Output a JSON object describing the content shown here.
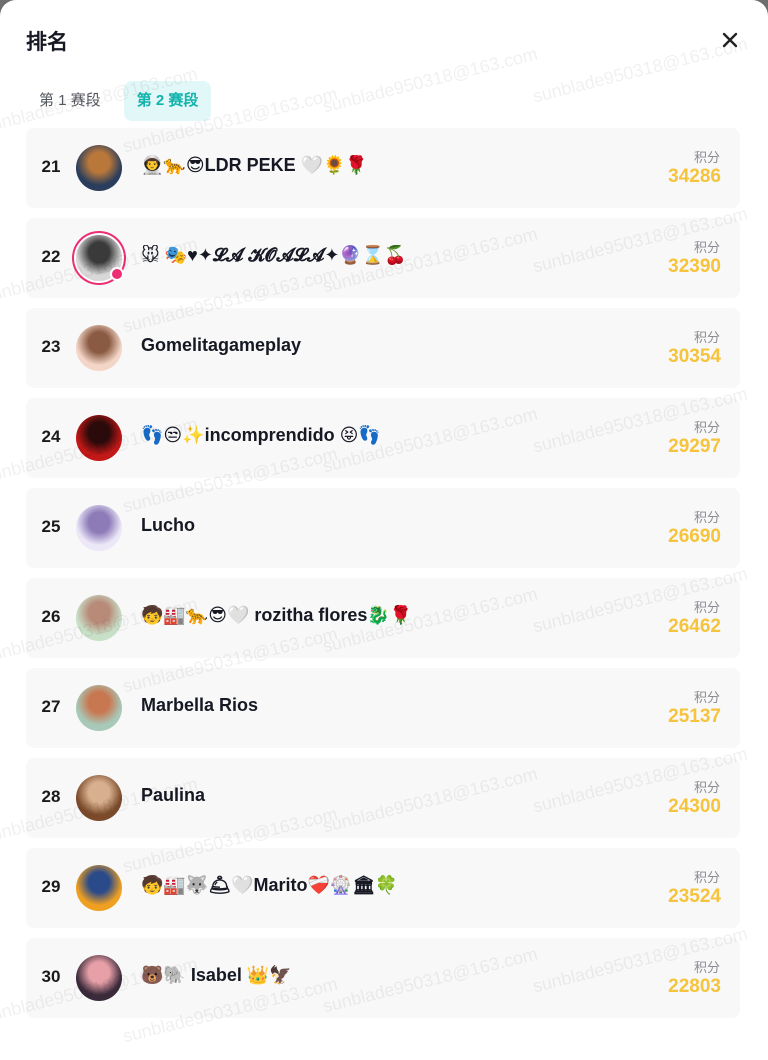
{
  "modal": {
    "title": "排名",
    "tabs": [
      {
        "label": "第 1 赛段",
        "active": false
      },
      {
        "label": "第 2 赛段",
        "active": true
      }
    ]
  },
  "points_label": "积分",
  "rankings": [
    {
      "rank": "21",
      "name": "👨‍🚀🐆😎LDR PEKE 🤍🌻🌹",
      "points": "34286",
      "avatar_colors": [
        "#2a3d5c",
        "#b9783a"
      ],
      "live": false
    },
    {
      "rank": "22",
      "name": "🐭 🎭♥✦𝓛𝓐 𝓚𝓞𝓐𝓛𝓐✦🔮⌛🍒",
      "points": "32390",
      "avatar_colors": [
        "#d8d8d8",
        "#3a3a3a"
      ],
      "live": true
    },
    {
      "rank": "23",
      "name": "Gomelitagameplay",
      "points": "30354",
      "avatar_colors": [
        "#f4d6c8",
        "#8a5a42"
      ],
      "live": false
    },
    {
      "rank": "24",
      "name": "👣😒✨incomprendido 😝👣",
      "points": "29297",
      "avatar_colors": [
        "#c21818",
        "#2a0a0a"
      ],
      "live": false
    },
    {
      "rank": "25",
      "name": "Lucho",
      "points": "26690",
      "avatar_colors": [
        "#ece8f8",
        "#8d7bb8"
      ],
      "live": false
    },
    {
      "rank": "26",
      "name": "🧒🏭🐆😎🤍 rozitha flores🐉🌹",
      "points": "26462",
      "avatar_colors": [
        "#c8e0c8",
        "#b88a78"
      ],
      "live": false
    },
    {
      "rank": "27",
      "name": "Marbella Rios",
      "points": "25137",
      "avatar_colors": [
        "#a8c8b8",
        "#c87850"
      ],
      "live": false
    },
    {
      "rank": "28",
      "name": "Paulina",
      "points": "24300",
      "avatar_colors": [
        "#7a4a2a",
        "#d8b090"
      ],
      "live": false
    },
    {
      "rank": "29",
      "name": "🧒🏭🐺🛎🤍Marito❤️‍🩹🎡🏛🍀",
      "points": "23524",
      "avatar_colors": [
        "#f0a020",
        "#2a4a8a"
      ],
      "live": false
    },
    {
      "rank": "30",
      "name": "🐻🐘 Isabel 👑🦅",
      "points": "22803",
      "avatar_colors": [
        "#3a2a3a",
        "#e8a0a8"
      ],
      "live": false
    }
  ],
  "watermark_text": "sunblade950318@163.com",
  "colors": {
    "accent_teal": "#11b3ad",
    "points_gold": "#f6c33c",
    "live_ring": "#ec2e74"
  }
}
